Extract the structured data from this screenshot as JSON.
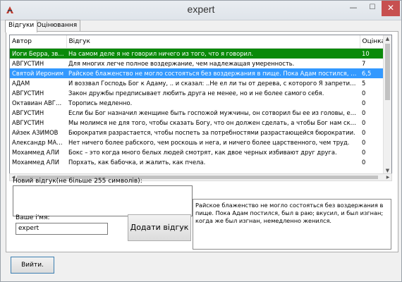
{
  "window": {
    "title": "expert",
    "minimize": "—",
    "maximize": "☐",
    "close": "✕"
  },
  "tabs": [
    {
      "label": "Відгуки",
      "active": true
    },
    {
      "label": "Оцінювання",
      "active": false
    }
  ],
  "reviews": {
    "columns": [
      "Автор",
      "Відгук",
      "Оцінка"
    ],
    "rows": [
      {
        "author": "Иоги Берра, зве...",
        "text": "На самом деле я не говорил ничего из того, что я говорил.",
        "score": "10",
        "state": "sel-green"
      },
      {
        "author": "АВГУСТИН",
        "text": "Для многих легче полное воздержание, чем надлежащая умеренность.",
        "score": "7",
        "state": ""
      },
      {
        "author": "Святой Иероним",
        "text": "Райское блаженство не могло состояться без воздержания в пище. Пока Адам постился, был в раю;",
        "score": "6,5",
        "state": "sel-blue"
      },
      {
        "author": "АДАМ",
        "text": "И воззвал Господь Бог к Адаму, .. и сказал: ..Не ел ли ты от дерева, с которого Я запретил тебе есть?",
        "score": "5",
        "state": ""
      },
      {
        "author": "АВГУСТИН",
        "text": "Закон дружбы предписывает любить друга не менее, но и не более самого себя.",
        "score": "0",
        "state": ""
      },
      {
        "author": "Октавиан АВГУСТ",
        "text": "Торопись медленно.",
        "score": "0",
        "state": ""
      },
      {
        "author": "АВГУСТИН",
        "text": "Если бы Бог назначил женщине быть госпожой мужчины, он сотворил бы ее из головы, если бы рабой",
        "score": "0",
        "state": ""
      },
      {
        "author": "АВГУСТИН",
        "text": "Мы молимся не для того, чтобы сказать Богу, что он должен сделать, а чтобы Бог нам сказал, что",
        "score": "0",
        "state": ""
      },
      {
        "author": "Айзек АЗИМОВ",
        "text": "Бюрократия разрастается, чтобы поспеть за потребностями разрастающейся бюрократии.",
        "score": "0",
        "state": ""
      },
      {
        "author": "Александр МАК...",
        "text": "Нет ничего более рабского, чем роскошь и нега, и ничего более царственного, чем труд.",
        "score": "0",
        "state": ""
      },
      {
        "author": "Мохаммед АЛИ",
        "text": "Бокс – это когда много белых людей смотрят, как двое черных избивают друг друга.",
        "score": "0",
        "state": ""
      },
      {
        "author": "Мохаммед АЛИ",
        "text": "Порхать, как бабочка, и жалить, как пчела.",
        "score": "0",
        "state": ""
      }
    ]
  },
  "form": {
    "new_review_label": "Новий відгук(не більше 255 символів):",
    "new_review_value": "",
    "name_label": "Ваше і'мя:",
    "name_value": "expert",
    "add_button": "Додати відгук",
    "preview_text": "Райское блаженство не могло состояться без воздержания в пище. Пока Адам постился, был в раю; вкусил, и был изгнан; когда же был изгнан, немедленно женился."
  },
  "exit_button": "Вийти.",
  "colors": {
    "row_green": "#0a8a0a",
    "row_blue": "#3399ff",
    "close_red": "#c75050"
  }
}
